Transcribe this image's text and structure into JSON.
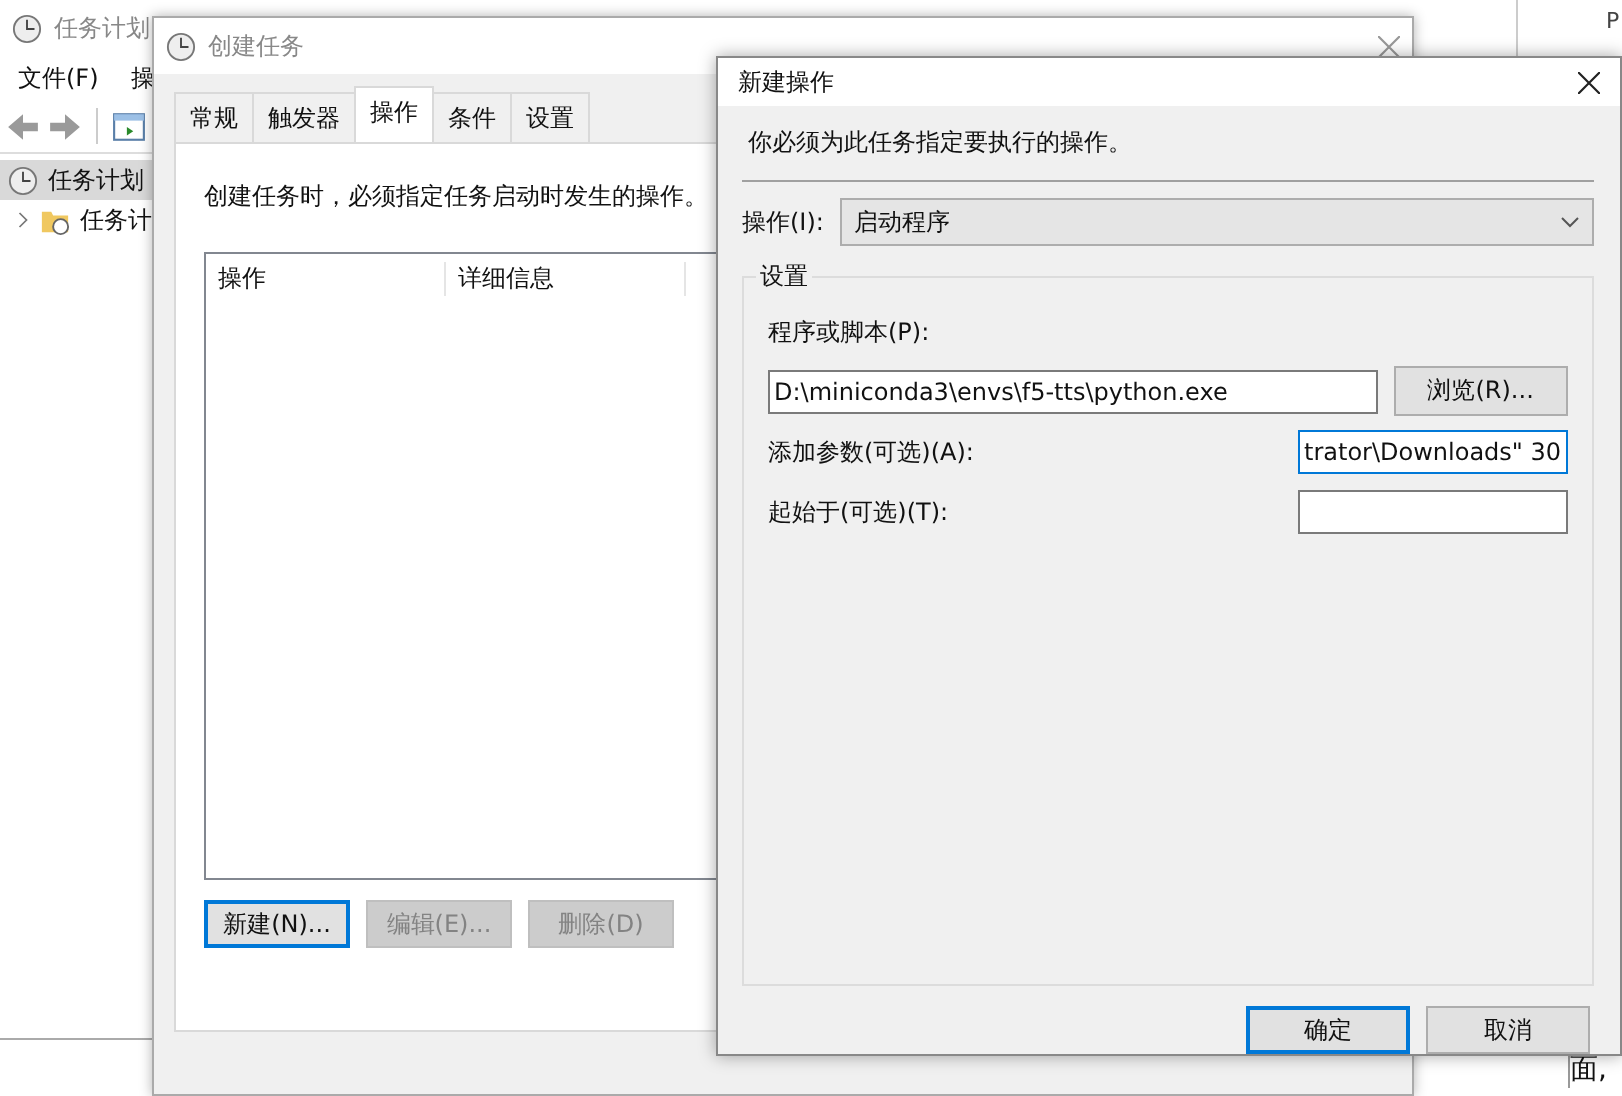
{
  "scheduler_window": {
    "title": "任务计划",
    "menu": [
      "文件(F)",
      "操"
    ],
    "tree": [
      {
        "label": "任务计划",
        "selected": true,
        "children": [
          {
            "label": "任务计",
            "selected": false,
            "expanded": false
          }
        ]
      }
    ],
    "corner_text": "P",
    "bottom_text": "面,"
  },
  "create_task_dialog": {
    "title": "创建任务",
    "tabs": [
      {
        "label": "常规",
        "selected": false
      },
      {
        "label": "触发器",
        "selected": false
      },
      {
        "label": "操作",
        "selected": true
      },
      {
        "label": "条件",
        "selected": false
      },
      {
        "label": "设置",
        "selected": false
      }
    ],
    "description": "创建任务时，必须指定任务启动时发生的操作。",
    "table": {
      "columns": [
        "操作",
        "详细信息"
      ]
    },
    "buttons": [
      {
        "label": "新建(N)...",
        "disabled": false,
        "default": true
      },
      {
        "label": "编辑(E)...",
        "disabled": true,
        "default": false
      },
      {
        "label": "删除(D)",
        "disabled": true,
        "default": false
      }
    ]
  },
  "new_action_dialog": {
    "title": "新建操作",
    "instruction": "你必须为此任务指定要执行的操作。",
    "action": {
      "label": "操作(I):",
      "value": "启动程序"
    },
    "settings": {
      "title": "设置",
      "fields": [
        {
          "kind": "browse",
          "label": "程序或脚本(P):",
          "value": "D:\\miniconda3\\envs\\f5-tts\\python.exe",
          "focused": false,
          "button": "浏览(R)..."
        },
        {
          "kind": "short",
          "label": "添加参数(可选)(A):",
          "value": "trator\\Downloads\" 30",
          "focused": true
        },
        {
          "kind": "short",
          "label": "起始于(可选)(T):",
          "focused": false
        }
      ]
    },
    "buttons": [
      {
        "label": "确定",
        "default": true
      },
      {
        "label": "取消",
        "default": false
      }
    ]
  }
}
